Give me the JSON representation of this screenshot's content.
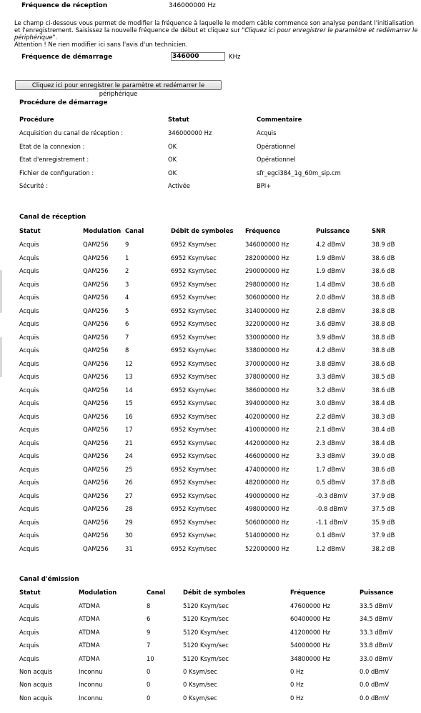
{
  "header": {
    "label": "Fréquence de réception",
    "value": "346000000 Hz"
  },
  "intro": {
    "text_before": "Le champ ci-dessous vous permet de modifier la fréquence à laquelle le modem câble commence son analyse pendant l'initialisation et l'enregistrement. Saisissez la nouvelle fréquence de début et cliquez sur ",
    "text_italic": "\"Cliquez ici pour enregistrer le paramètre et redémarrer le périphérique\"",
    "text_after": ".",
    "warning": "Attention ! Ne rien modifier ici sans l'avis d'un technicien."
  },
  "start_freq": {
    "label": "Fréquence de démarrage",
    "value": "346000",
    "unit": "KHz"
  },
  "apply_button": "Cliquez ici pour enregistrer le paramètre et redémarrer le périphérique",
  "startup": {
    "title": "Procédure de démarrage",
    "headers": [
      "Procédure",
      "Statut",
      "Commentaire"
    ],
    "rows": [
      [
        "Acquisition du canal de réception :",
        "346000000 Hz",
        "Acquis"
      ],
      [
        "Etat de la connexion :",
        "OK",
        "Opérationnel"
      ],
      [
        "Etat d'enregistrement :",
        "OK",
        "Opérationnel"
      ],
      [
        "Fichier de configuration :",
        "OK",
        "sfr_egci384_1g_60m_sip.cm"
      ],
      [
        "Sécurité :",
        "Activée",
        "BPI+"
      ]
    ]
  },
  "downstream": {
    "title": "Canal de réception",
    "headers": [
      "Statut",
      "Modulation",
      "Canal",
      "Débit de symboles",
      "Fréquence",
      "Puissance",
      "SNR"
    ],
    "rows": [
      [
        "Acquis",
        "QAM256",
        "9",
        "6952 Ksym/sec",
        "346000000 Hz",
        "4.2 dBmV",
        "38.9 dB"
      ],
      [
        "Acquis",
        "QAM256",
        "1",
        "6952 Ksym/sec",
        "282000000 Hz",
        "1.9 dBmV",
        "38.6 dB"
      ],
      [
        "Acquis",
        "QAM256",
        "2",
        "6952 Ksym/sec",
        "290000000 Hz",
        "1.9 dBmV",
        "38.6 dB"
      ],
      [
        "Acquis",
        "QAM256",
        "3",
        "6952 Ksym/sec",
        "298000000 Hz",
        "1.4 dBmV",
        "38.6 dB"
      ],
      [
        "Acquis",
        "QAM256",
        "4",
        "6952 Ksym/sec",
        "306000000 Hz",
        "2.0 dBmV",
        "38.8 dB"
      ],
      [
        "Acquis",
        "QAM256",
        "5",
        "6952 Ksym/sec",
        "314000000 Hz",
        "2.8 dBmV",
        "38.8 dB"
      ],
      [
        "Acquis",
        "QAM256",
        "6",
        "6952 Ksym/sec",
        "322000000 Hz",
        "3.6 dBmV",
        "38.8 dB"
      ],
      [
        "Acquis",
        "QAM256",
        "7",
        "6952 Ksym/sec",
        "330000000 Hz",
        "3.9 dBmV",
        "38.8 dB"
      ],
      [
        "Acquis",
        "QAM256",
        "8",
        "6952 Ksym/sec",
        "338000000 Hz",
        "4.2 dBmV",
        "38.8 dB"
      ],
      [
        "Acquis",
        "QAM256",
        "12",
        "6952 Ksym/sec",
        "370000000 Hz",
        "3.8 dBmV",
        "38.6 dB"
      ],
      [
        "Acquis",
        "QAM256",
        "13",
        "6952 Ksym/sec",
        "378000000 Hz",
        "3.3 dBmV",
        "38.5 dB"
      ],
      [
        "Acquis",
        "QAM256",
        "14",
        "6952 Ksym/sec",
        "386000000 Hz",
        "3.2 dBmV",
        "38.6 dB"
      ],
      [
        "Acquis",
        "QAM256",
        "15",
        "6952 Ksym/sec",
        "394000000 Hz",
        "3.0 dBmV",
        "38.4 dB"
      ],
      [
        "Acquis",
        "QAM256",
        "16",
        "6952 Ksym/sec",
        "402000000 Hz",
        "2.2 dBmV",
        "38.3 dB"
      ],
      [
        "Acquis",
        "QAM256",
        "17",
        "6952 Ksym/sec",
        "410000000 Hz",
        "2.1 dBmV",
        "38.4 dB"
      ],
      [
        "Acquis",
        "QAM256",
        "21",
        "6952 Ksym/sec",
        "442000000 Hz",
        "2.3 dBmV",
        "38.4 dB"
      ],
      [
        "Acquis",
        "QAM256",
        "24",
        "6952 Ksym/sec",
        "466000000 Hz",
        "3.3 dBmV",
        "39.0 dB"
      ],
      [
        "Acquis",
        "QAM256",
        "25",
        "6952 Ksym/sec",
        "474000000 Hz",
        "1.7 dBmV",
        "38.6 dB"
      ],
      [
        "Acquis",
        "QAM256",
        "26",
        "6952 Ksym/sec",
        "482000000 Hz",
        "0.5 dBmV",
        "37.8 dB"
      ],
      [
        "Acquis",
        "QAM256",
        "27",
        "6952 Ksym/sec",
        "490000000 Hz",
        "-0.3 dBmV",
        "37.9 dB"
      ],
      [
        "Acquis",
        "QAM256",
        "28",
        "6952 Ksym/sec",
        "498000000 Hz",
        "-0.8 dBmV",
        "37.5 dB"
      ],
      [
        "Acquis",
        "QAM256",
        "29",
        "6952 Ksym/sec",
        "506000000 Hz",
        "-1.1 dBmV",
        "35.9 dB"
      ],
      [
        "Acquis",
        "QAM256",
        "30",
        "6952 Ksym/sec",
        "514000000 Hz",
        "0.1 dBmV",
        "37.9 dB"
      ],
      [
        "Acquis",
        "QAM256",
        "31",
        "6952 Ksym/sec",
        "522000000 Hz",
        "1.2 dBmV",
        "38.2 dB"
      ]
    ]
  },
  "upstream": {
    "title": "Canal d'émission",
    "headers": [
      "Statut",
      "Modulation",
      "Canal",
      "Débit de symboles",
      "Fréquence",
      "Puissance"
    ],
    "rows": [
      [
        "Acquis",
        "ATDMA",
        "8",
        "5120 Ksym/sec",
        "47600000 Hz",
        "33.5 dBmV"
      ],
      [
        "Acquis",
        "ATDMA",
        "6",
        "5120 Ksym/sec",
        "60400000 Hz",
        "34.5 dBmV"
      ],
      [
        "Acquis",
        "ATDMA",
        "9",
        "5120 Ksym/sec",
        "41200000 Hz",
        "33.3 dBmV"
      ],
      [
        "Acquis",
        "ATDMA",
        "7",
        "5120 Ksym/sec",
        "54000000 Hz",
        "33.8 dBmV"
      ],
      [
        "Acquis",
        "ATDMA",
        "10",
        "5120 Ksym/sec",
        "34800000 Hz",
        "33.0 dBmV"
      ],
      [
        "Non acquis",
        "Inconnu",
        "0",
        "0 Ksym/sec",
        "0 Hz",
        "0.0 dBmV"
      ],
      [
        "Non acquis",
        "Inconnu",
        "0",
        "0 Ksym/sec",
        "0 Hz",
        "0.0 dBmV"
      ],
      [
        "Non acquis",
        "Inconnu",
        "0",
        "0 Ksym/sec",
        "0 Hz",
        "0.0 dBmV"
      ]
    ]
  }
}
